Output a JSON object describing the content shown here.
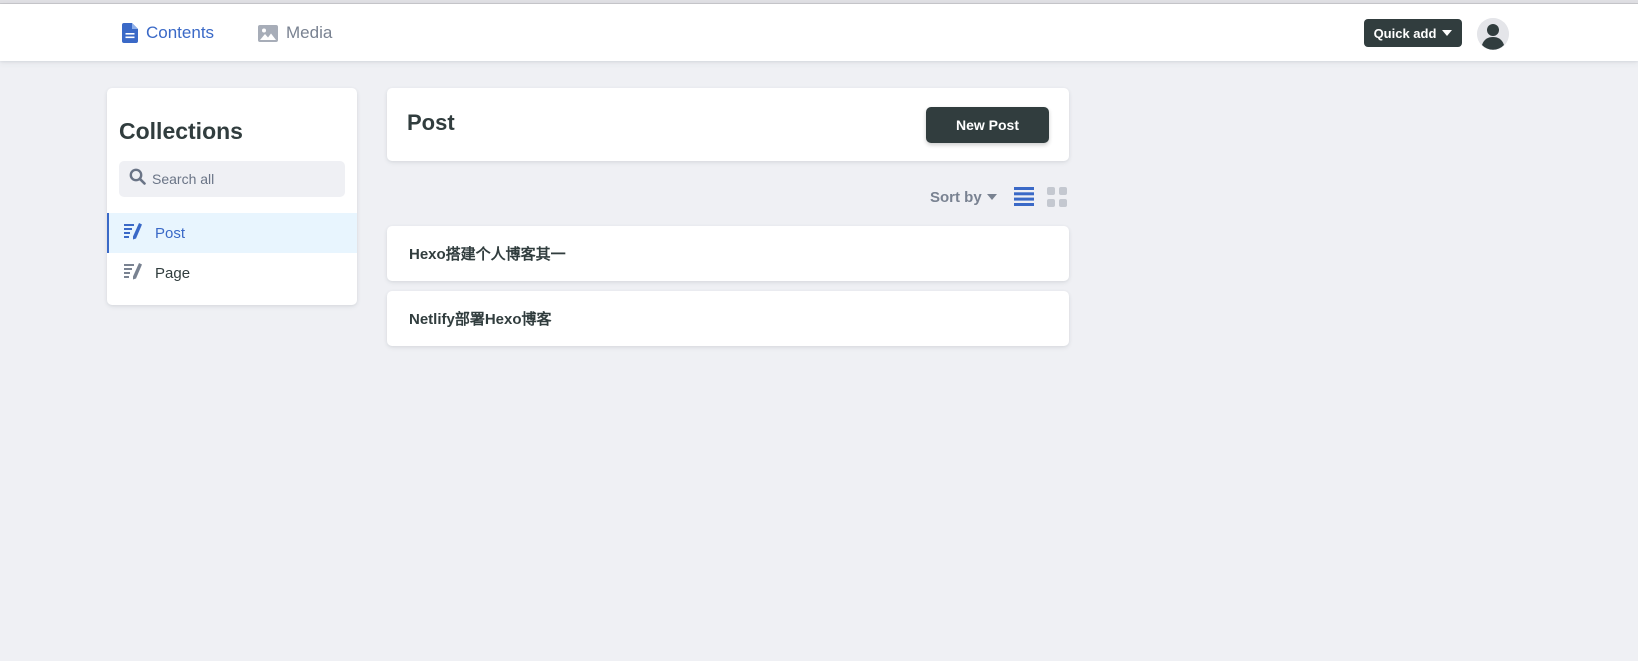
{
  "header": {
    "nav": [
      {
        "label": "Contents",
        "icon": "document-icon",
        "active": true
      },
      {
        "label": "Media",
        "icon": "image-icon",
        "active": false
      }
    ],
    "quick_add_label": "Quick add",
    "avatar_icon": "user-avatar-icon"
  },
  "sidebar": {
    "title": "Collections",
    "search_placeholder": "Search all",
    "items": [
      {
        "label": "Post",
        "icon": "collection-icon",
        "active": true
      },
      {
        "label": "Page",
        "icon": "collection-icon",
        "active": false
      }
    ]
  },
  "collection": {
    "title": "Post",
    "new_button_label": "New Post",
    "sort_label": "Sort by",
    "view_modes": [
      "list",
      "grid"
    ],
    "active_view": "list",
    "entries": [
      {
        "title": "Hexo搭建个人博客其一"
      },
      {
        "title": "Netlify部署Hexo博客"
      }
    ]
  },
  "colors": {
    "accent": "#3a69c7",
    "dark": "#313d3e",
    "muted": "#798291",
    "background": "#eff0f4",
    "active_bg": "#e8f5fe"
  }
}
